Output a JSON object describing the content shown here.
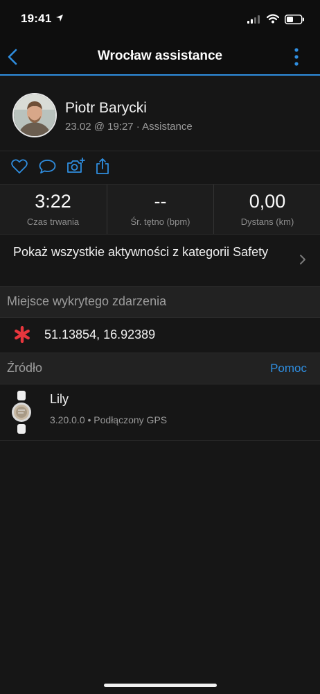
{
  "status_bar": {
    "time": "19:41"
  },
  "nav": {
    "title": "Wrocław assistance"
  },
  "profile": {
    "name": "Piotr Barycki",
    "meta": "23.02 @ 19:27 · Assistance"
  },
  "actions": [
    "heart-icon",
    "comment-icon",
    "camera-add-icon",
    "share-icon"
  ],
  "stats": [
    {
      "value": "3:22",
      "label": "Czas trwania"
    },
    {
      "value": "--",
      "label": "Śr. tętno (bpm)"
    },
    {
      "value": "0,00",
      "label": "Dystans (km)"
    }
  ],
  "show_all": {
    "label": "Pokaż wszystkie aktywności z kategorii Safety"
  },
  "incident": {
    "header": "Miejsce wykrytego zdarzenia",
    "coordinates": "51.13854, 16.92389"
  },
  "source": {
    "header": "Źródło",
    "help": "Pomoc",
    "device_name": "Lily",
    "device_meta": "3.20.0.0 • Podłączony GPS"
  },
  "colors": {
    "accent": "#2f8ee0",
    "incident": "#e8363d",
    "background": "#161616"
  }
}
